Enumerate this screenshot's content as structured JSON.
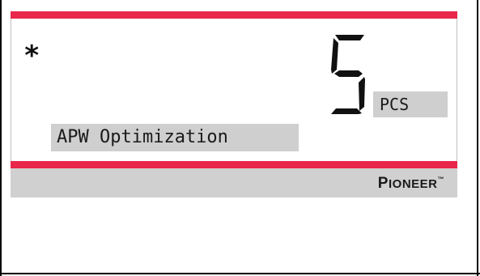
{
  "display": {
    "indicator": "*",
    "reading": "5",
    "unit": "PCS",
    "message": "APW Optimization"
  },
  "brand": {
    "initial_p": "P",
    "rest_a": "IONEER",
    "trademark": "™"
  },
  "colors": {
    "accent_red": "#e8274a",
    "panel_gray": "#cfcfcf",
    "footer_gray": "#d0d0d0",
    "segment": "#111111"
  }
}
